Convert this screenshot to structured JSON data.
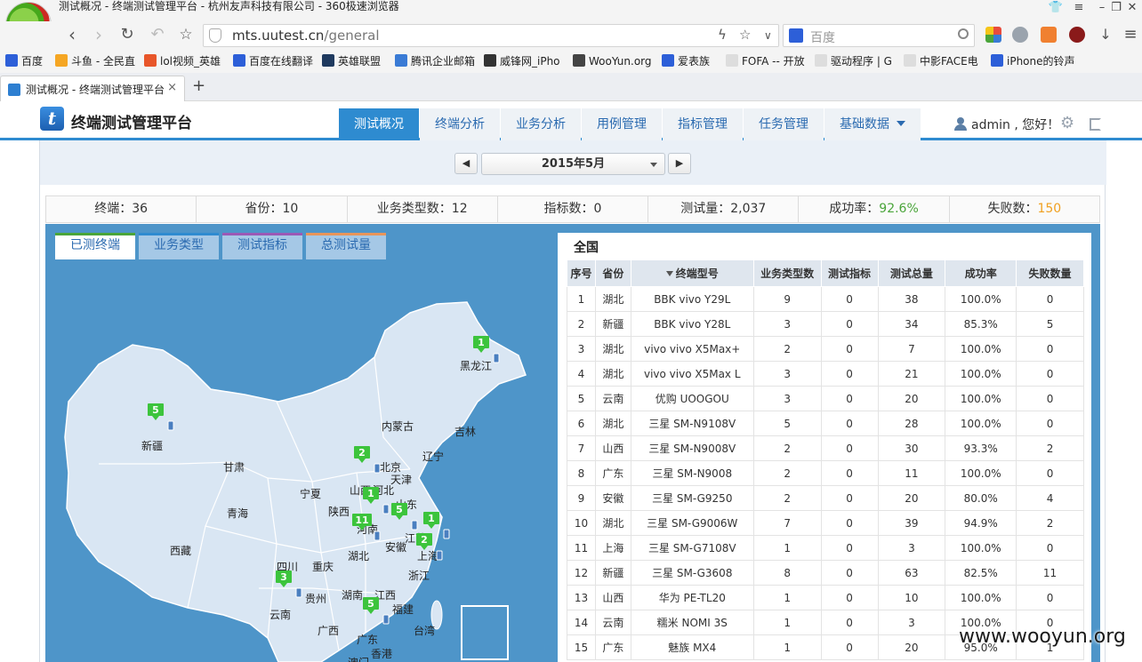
{
  "browser": {
    "window_title": "测试概况 - 终端测试管理平台 - 杭州友声科技有限公司 - 360极速浏览器",
    "address": {
      "domain": "mts.uutest.cn",
      "path": "/general"
    },
    "search_placeholder": "百度",
    "bookmarks": [
      {
        "label": "百度",
        "color": "#2d5fd8"
      },
      {
        "label": "斗鱼 - 全民直",
        "color": "#f5a623"
      },
      {
        "label": "lol视频_英雄",
        "color": "#e8562a"
      },
      {
        "label": "百度在线翻译",
        "color": "#2d5fd8"
      },
      {
        "label": "英雄联盟",
        "color": "#1f3a5f"
      },
      {
        "label": "腾讯企业邮箱",
        "color": "#3a7bd5"
      },
      {
        "label": "威锋网_iPho",
        "color": "#333333"
      },
      {
        "label": "WooYun.org",
        "color": "#444444"
      },
      {
        "label": "爱表族",
        "color": "#2d5fd8"
      },
      {
        "label": "FOFA -- 开放",
        "color": "#dddddd"
      },
      {
        "label": "驱动程序 | G",
        "color": "#dddddd"
      },
      {
        "label": "中影FACE电",
        "color": "#dddddd"
      },
      {
        "label": "iPhone的铃声",
        "color": "#2d5fd8"
      }
    ],
    "tab_title": "测试概况 - 终端测试管理平台",
    "tab_close": "×",
    "new_tab": "+"
  },
  "app": {
    "logo_letter": "t",
    "title": "终端测试管理平台",
    "nav": [
      {
        "label": "测试概况",
        "active": true
      },
      {
        "label": "终端分析",
        "active": false
      },
      {
        "label": "业务分析",
        "active": false
      },
      {
        "label": "用例管理",
        "active": false
      },
      {
        "label": "指标管理",
        "active": false
      },
      {
        "label": "任务管理",
        "active": false
      },
      {
        "label": "基础数据",
        "active": false,
        "dropdown": true
      }
    ],
    "user_greeting": "admin , 您好！"
  },
  "month": {
    "selected": "2015年5月",
    "prev": "◀",
    "next": "▶"
  },
  "stats": [
    {
      "label": "终端：",
      "value": "36",
      "color": ""
    },
    {
      "label": "省份：",
      "value": "10",
      "color": ""
    },
    {
      "label": "业务类型数：",
      "value": "12",
      "color": ""
    },
    {
      "label": "指标数：",
      "value": "0",
      "color": ""
    },
    {
      "label": "测试量：",
      "value": "2,037",
      "color": ""
    },
    {
      "label": "成功率：",
      "value": "92.6%",
      "color": "green"
    },
    {
      "label": "失败数：",
      "value": "150",
      "color": "orange"
    }
  ],
  "map_tabs": [
    {
      "label": "已测终端",
      "active": true,
      "accent": "#4aa53a"
    },
    {
      "label": "业务类型",
      "active": false,
      "accent": "#2e8bd0"
    },
    {
      "label": "测试指标",
      "active": false,
      "accent": "#9b59b6"
    },
    {
      "label": "总测试量",
      "active": false,
      "accent": "#e8955a"
    }
  ],
  "map_provinces": [
    {
      "name": "黑龙江"
    },
    {
      "name": "新疆"
    },
    {
      "name": "内蒙古"
    },
    {
      "name": "吉林"
    },
    {
      "name": "甘肃"
    },
    {
      "name": "北京"
    },
    {
      "name": "辽宁"
    },
    {
      "name": "天津"
    },
    {
      "name": "宁夏"
    },
    {
      "name": "山西"
    },
    {
      "name": "河北"
    },
    {
      "name": "青海"
    },
    {
      "name": "陕西"
    },
    {
      "name": "山东"
    },
    {
      "name": "河南"
    },
    {
      "name": "江苏"
    },
    {
      "name": "安徽"
    },
    {
      "name": "西藏"
    },
    {
      "name": "湖北"
    },
    {
      "name": "上海"
    },
    {
      "name": "四川"
    },
    {
      "name": "重庆"
    },
    {
      "name": "浙江"
    },
    {
      "name": "贵州"
    },
    {
      "name": "湖南"
    },
    {
      "name": "江西"
    },
    {
      "name": "福建"
    },
    {
      "name": "云南"
    },
    {
      "name": "广西"
    },
    {
      "name": "广东"
    },
    {
      "name": "台湾"
    },
    {
      "name": "香港"
    },
    {
      "name": "澳门"
    }
  ],
  "map_markers": [
    {
      "count": "1",
      "province": "黑龙江"
    },
    {
      "count": "5",
      "province": "新疆"
    },
    {
      "count": "2",
      "province": "山西"
    },
    {
      "count": "1",
      "province": "河南"
    },
    {
      "count": "5",
      "province": "安徽"
    },
    {
      "count": "1",
      "province": "江苏"
    },
    {
      "count": "11",
      "province": "湖北"
    },
    {
      "count": "2",
      "province": "上海"
    },
    {
      "count": "3",
      "province": "云南"
    },
    {
      "count": "5",
      "province": "广东"
    }
  ],
  "table": {
    "region": "全国",
    "headers": [
      "序号",
      "省份",
      "终端型号",
      "业务类型数",
      "测试指标",
      "测试总量",
      "成功率",
      "失败数量"
    ],
    "rows": [
      [
        "1",
        "湖北",
        "BBK vivo Y29L",
        "9",
        "0",
        "38",
        "100.0%",
        "0"
      ],
      [
        "2",
        "新疆",
        "BBK vivo Y28L",
        "3",
        "0",
        "34",
        "85.3%",
        "5"
      ],
      [
        "3",
        "湖北",
        "vivo vivo X5Max+",
        "2",
        "0",
        "7",
        "100.0%",
        "0"
      ],
      [
        "4",
        "湖北",
        "vivo vivo X5Max L",
        "3",
        "0",
        "21",
        "100.0%",
        "0"
      ],
      [
        "5",
        "云南",
        "优购 UOOGOU",
        "3",
        "0",
        "20",
        "100.0%",
        "0"
      ],
      [
        "6",
        "湖北",
        "三星 SM-N9108V",
        "5",
        "0",
        "28",
        "100.0%",
        "0"
      ],
      [
        "7",
        "山西",
        "三星 SM-N9008V",
        "2",
        "0",
        "30",
        "93.3%",
        "2"
      ],
      [
        "8",
        "广东",
        "三星 SM-N9008",
        "2",
        "0",
        "11",
        "100.0%",
        "0"
      ],
      [
        "9",
        "安徽",
        "三星 SM-G9250",
        "2",
        "0",
        "20",
        "80.0%",
        "4"
      ],
      [
        "10",
        "湖北",
        "三星 SM-G9006W",
        "7",
        "0",
        "39",
        "94.9%",
        "2"
      ],
      [
        "11",
        "上海",
        "三星 SM-G7108V",
        "1",
        "0",
        "3",
        "100.0%",
        "0"
      ],
      [
        "12",
        "新疆",
        "三星 SM-G3608",
        "8",
        "0",
        "63",
        "82.5%",
        "11"
      ],
      [
        "13",
        "山西",
        "华为 PE-TL20",
        "1",
        "0",
        "10",
        "100.0%",
        "0"
      ],
      [
        "14",
        "云南",
        "糯米 NOMI 3S",
        "1",
        "0",
        "3",
        "100.0%",
        "0"
      ],
      [
        "15",
        "广东",
        "魅族 MX4",
        "1",
        "0",
        "20",
        "95.0%",
        "1"
      ]
    ]
  },
  "watermark": "www.wooyun.org"
}
